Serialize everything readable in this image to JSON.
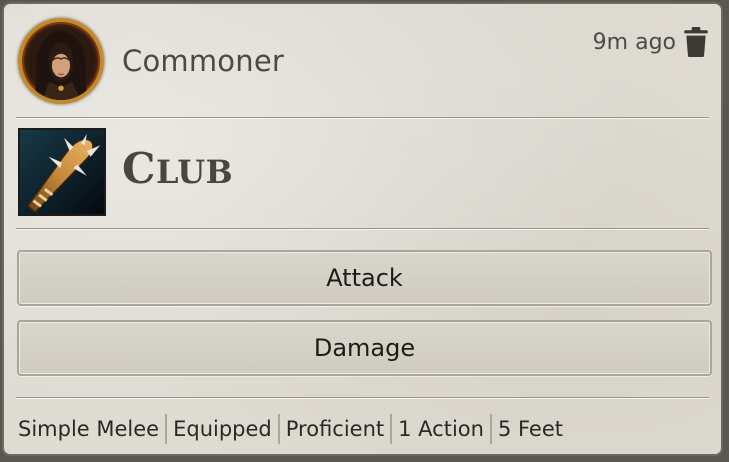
{
  "card": {
    "actor_name": "Commoner",
    "timestamp": "9m ago",
    "delete_icon": "trash-icon",
    "avatar_icon": "hooded-figure-portrait",
    "item": {
      "name_cap": "C",
      "name_rest": "lub",
      "image_icon": "club-weapon-image"
    },
    "buttons": {
      "attack": "Attack",
      "damage": "Damage"
    },
    "tags": [
      "Simple Melee",
      "Equipped",
      "Proficient",
      "1 Action",
      "5 Feet"
    ]
  }
}
